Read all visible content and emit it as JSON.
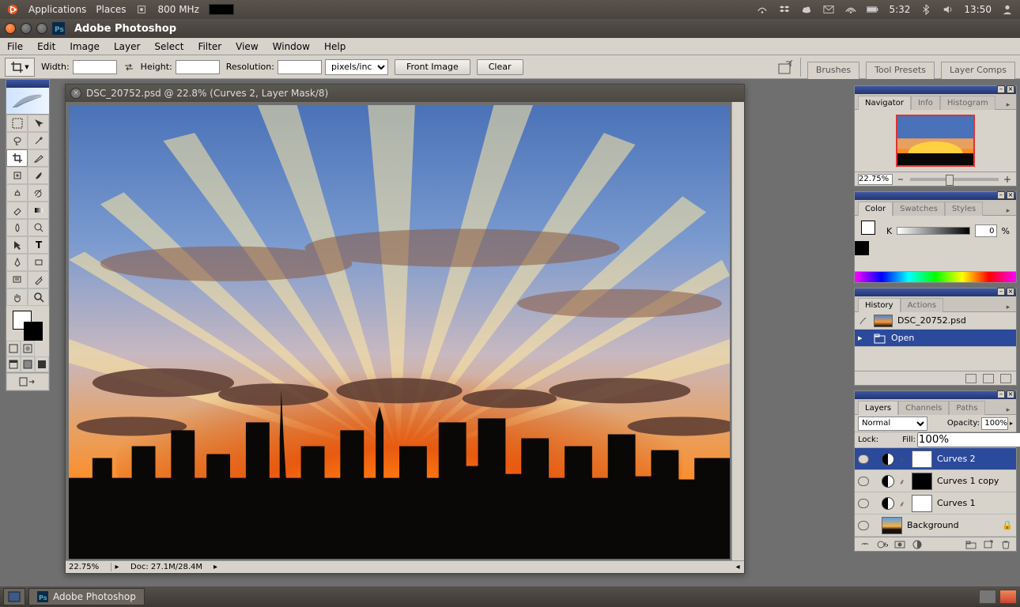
{
  "os": {
    "applications": "Applications",
    "places": "Places",
    "cpu": "800 MHz",
    "battery_time": "5:32",
    "clock": "13:50"
  },
  "app": {
    "title": "Adobe Photoshop"
  },
  "menu": {
    "file": "File",
    "edit": "Edit",
    "image": "Image",
    "layer": "Layer",
    "select": "Select",
    "filter": "Filter",
    "view": "View",
    "window": "Window",
    "help": "Help"
  },
  "options": {
    "width_label": "Width:",
    "width_value": "",
    "height_label": "Height:",
    "height_value": "",
    "resolution_label": "Resolution:",
    "resolution_value": "",
    "units": "pixels/inch",
    "front_image": "Front Image",
    "clear": "Clear",
    "dock_tabs": {
      "brushes": "Brushes",
      "tool_presets": "Tool Presets",
      "layer_comps": "Layer Comps"
    }
  },
  "document": {
    "title": "DSC_20752.psd @ 22.8% (Curves 2, Layer Mask/8)",
    "zoom": "22.75%",
    "doc_info": "Doc: 27.1M/28.4M"
  },
  "navigator": {
    "tab_navigator": "Navigator",
    "tab_info": "Info",
    "tab_histogram": "Histogram",
    "zoom": "22.75%"
  },
  "color": {
    "tab_color": "Color",
    "tab_swatches": "Swatches",
    "tab_styles": "Styles",
    "k_label": "K",
    "k_value": "0",
    "k_pct": "%"
  },
  "history": {
    "tab_history": "History",
    "tab_actions": "Actions",
    "doc_name": "DSC_20752.psd",
    "step_open": "Open"
  },
  "layers": {
    "tab_layers": "Layers",
    "tab_channels": "Channels",
    "tab_paths": "Paths",
    "blend_mode": "Normal",
    "opacity_label": "Opacity:",
    "opacity_value": "100%",
    "lock_label": "Lock:",
    "fill_label": "Fill:",
    "fill_value": "100%",
    "items": [
      {
        "name": "Curves 2"
      },
      {
        "name": "Curves 1 copy"
      },
      {
        "name": "Curves 1"
      },
      {
        "name": "Background"
      }
    ]
  },
  "taskbar": {
    "app": "Adobe Photoshop"
  }
}
